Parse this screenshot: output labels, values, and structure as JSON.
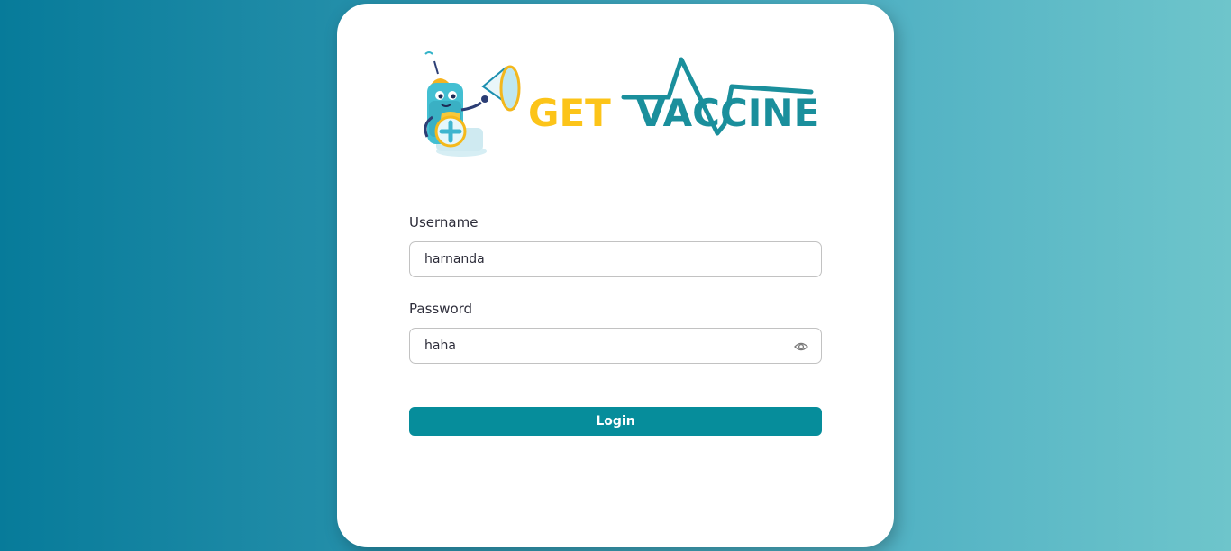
{
  "brand": {
    "word1": "GET",
    "word2": "VACCINE",
    "word1_color": "#fcc419",
    "word2_color": "#1a8f9c"
  },
  "form": {
    "username_label": "Username",
    "username_value": "harnanda",
    "password_label": "Password",
    "password_value": "haha",
    "login_label": "Login"
  },
  "colors": {
    "accent": "#068d9b",
    "background_start": "#077b9a",
    "background_end": "#6ec5cb"
  },
  "icons": {
    "mascot": "syringe-mascot-icon",
    "password_toggle": "eye-icon"
  }
}
